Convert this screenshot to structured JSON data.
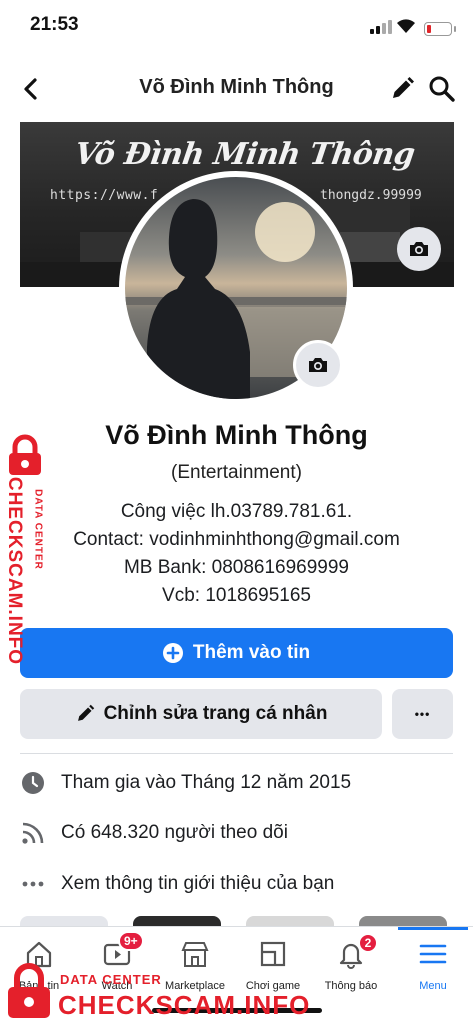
{
  "status_bar": {
    "time": "21:53",
    "battery_level": 0.2
  },
  "nav": {
    "title": "Võ Đình Minh Thông"
  },
  "cover": {
    "title": "Võ Đình Minh Thông",
    "url": "https://www.f",
    "url_end": "thongdz.99999"
  },
  "profile": {
    "name": "Võ Đình Minh Thông",
    "category": "(Entertainment)",
    "bio": [
      "Công việc lh.03789.781.61.",
      "Contact: vodinhminhthong@gmail.com",
      "MB Bank: 0808616969999",
      "Vcb: 1018695165"
    ]
  },
  "actions": {
    "add_story_label": "Thêm vào tin",
    "edit_profile_label": "Chỉnh sửa trang cá nhân",
    "more_label": "•••"
  },
  "details": [
    {
      "icon": "clock-icon",
      "text": "Tham gia vào Tháng 12 năm 2015"
    },
    {
      "icon": "rss-icon",
      "text": "Có 648.320 người theo dõi"
    },
    {
      "icon": "more-dots-icon",
      "text": "Xem thông tin giới thiệu của bạn"
    }
  ],
  "tabs": [
    {
      "label": "Bảng tin",
      "icon": "home-icon"
    },
    {
      "label": "Watch",
      "icon": "watch-icon",
      "badge": "9+"
    },
    {
      "label": "Marketplace",
      "icon": "marketplace-icon"
    },
    {
      "label": "Chơi game",
      "icon": "gaming-icon"
    },
    {
      "label": "Thông báo",
      "icon": "bell-icon",
      "badge": "2"
    },
    {
      "label": "Menu",
      "icon": "menu-icon",
      "active": true
    }
  ],
  "watermark": {
    "side_primary": "CHECKSCAM.INFO",
    "side_secondary": "DATA CENTER",
    "bottom_primary": "CHECKSCAM.INFO",
    "bottom_secondary": "DATA CENTER"
  },
  "colors": {
    "accent": "#1877f2",
    "badge": "#e41e3f",
    "watermark": "#e4202b"
  }
}
